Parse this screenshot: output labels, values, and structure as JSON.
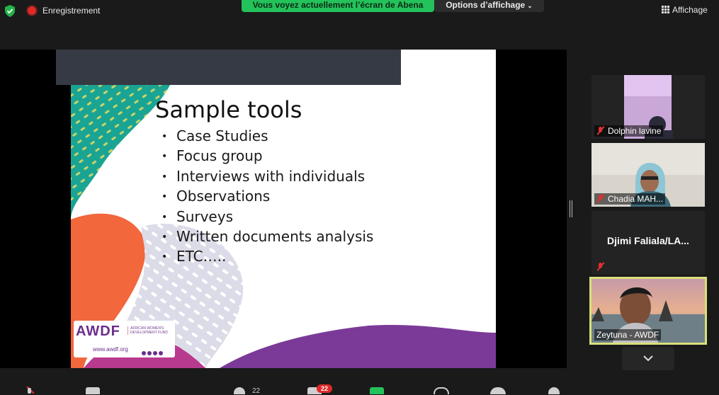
{
  "topbar": {
    "recording_label": "Enregistrement",
    "viewing_banner": "Vous voyez actuellement l’écran de Abena",
    "view_options_label": "Options d’affichage",
    "display_label": "Affichage"
  },
  "slide": {
    "title": "Sample tools",
    "bullets": [
      "Case Studies",
      "Focus group",
      "Interviews with individuals",
      "Observations",
      "Surveys",
      "Written documents analysis",
      "ETC….."
    ],
    "logo_text": "AWDF",
    "logo_subtext": "AFRICAN WOMEN'S DEVELOPMENT FUND",
    "logo_url": "www.awdf.org"
  },
  "participants": [
    {
      "name": "Dolphin lavine",
      "muted": true,
      "video": true
    },
    {
      "name": "Chadia MAH...",
      "muted": true,
      "video": true
    },
    {
      "name": "Djimi  Faliala/LA...",
      "muted": true,
      "video": false
    },
    {
      "name": "Zeytuna - AWDF",
      "muted": false,
      "video": true,
      "active_speaker": true
    }
  ],
  "toolbar": {
    "participants_count": "22",
    "chat_badge": "22"
  },
  "colors": {
    "viewing_banner": "#24c25a",
    "active_speaker_border": "#d9e07a",
    "mic_muted": "#e03030",
    "awdf_purple": "#6b2d8c"
  }
}
